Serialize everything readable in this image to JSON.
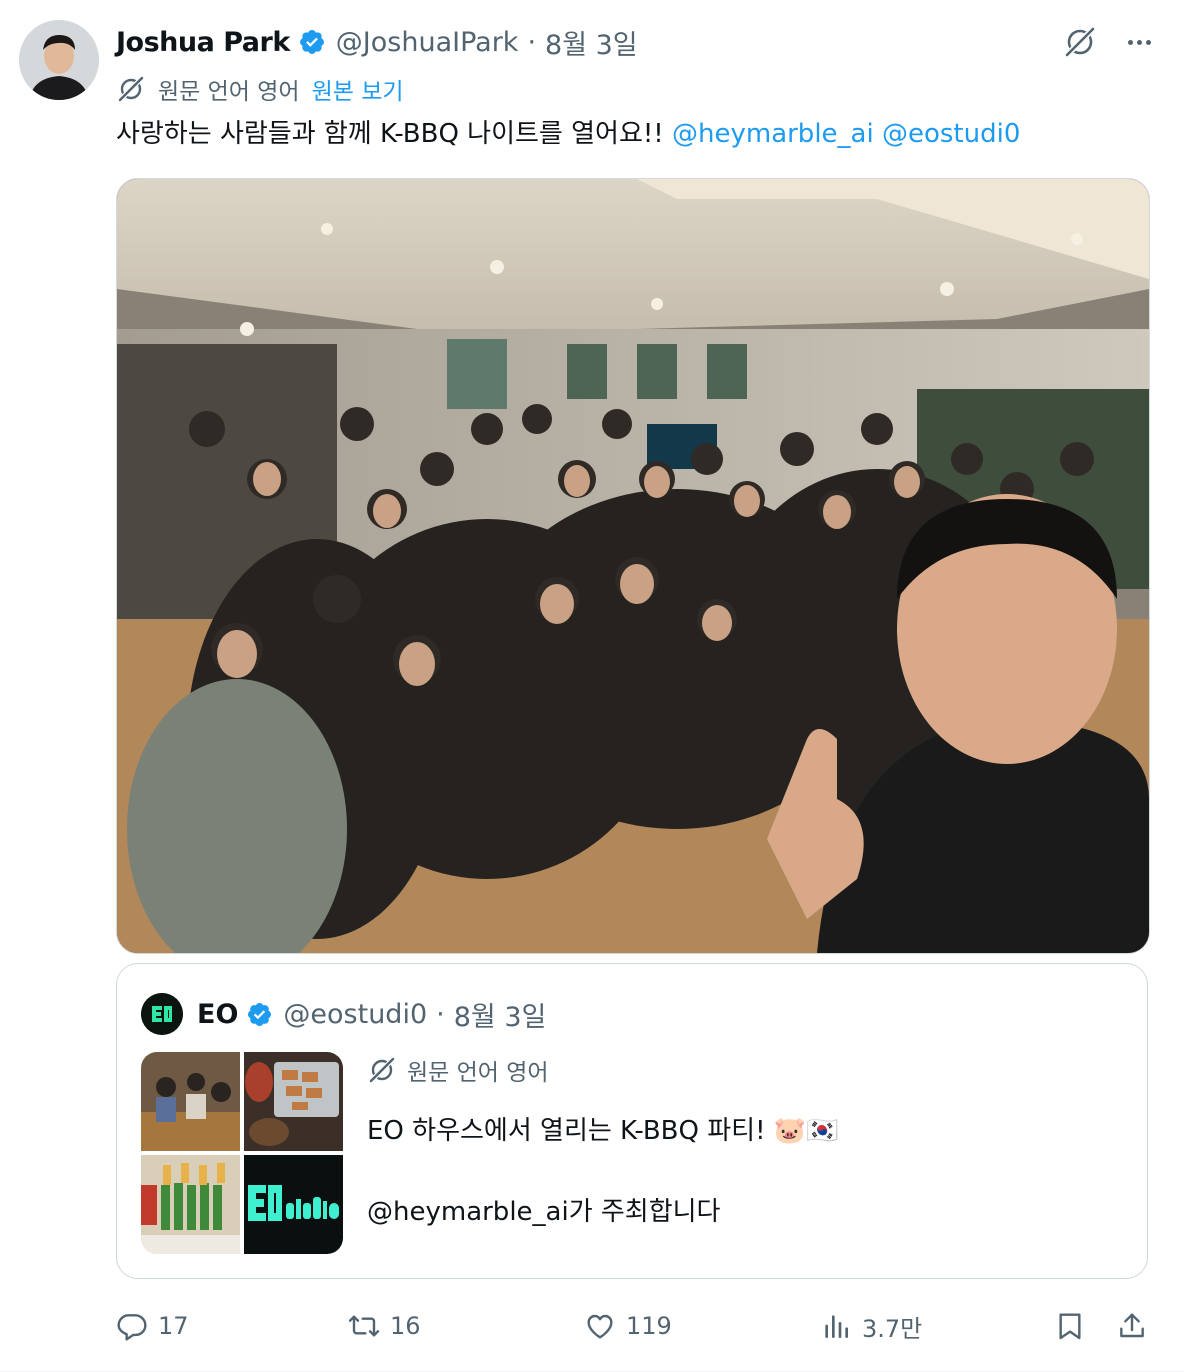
{
  "tweet": {
    "author_name": "Joshua Park",
    "author_handle": "@JoshuaIPark",
    "separator": "·",
    "date": "8월 3일",
    "translate_label": "원문 언어 영어",
    "view_original": "원본 보기",
    "text_main": "사랑하는 사람들과 함께 K-BBQ 나이트를 열어요!! ",
    "mention_1": "@heymarble_ai",
    "mention_2": "@eostudi0"
  },
  "quote": {
    "author_name": "EO",
    "author_handle": "@eostudi0",
    "separator": "·",
    "date": "8월 3일",
    "translate_label": "원문 언어 영어",
    "line1": "EO 하우스에서 열리는 K-BBQ 파티! 🐷🇰🇷",
    "line2": "@heymarble_ai가 주최합니다"
  },
  "actions": {
    "replies": "17",
    "reposts": "16",
    "likes": "119",
    "views": "3.7만"
  },
  "icons": {
    "verified": "verified-badge-icon",
    "grok": "grok-icon",
    "more": "more-icon",
    "translate": "translate-icon",
    "reply": "reply-icon",
    "repost": "repost-icon",
    "like": "like-icon",
    "views": "views-icon",
    "bookmark": "bookmark-icon",
    "share": "share-icon"
  },
  "colors": {
    "accent": "#1d9bf0",
    "text_secondary": "#536471",
    "border": "#cfd9de"
  }
}
